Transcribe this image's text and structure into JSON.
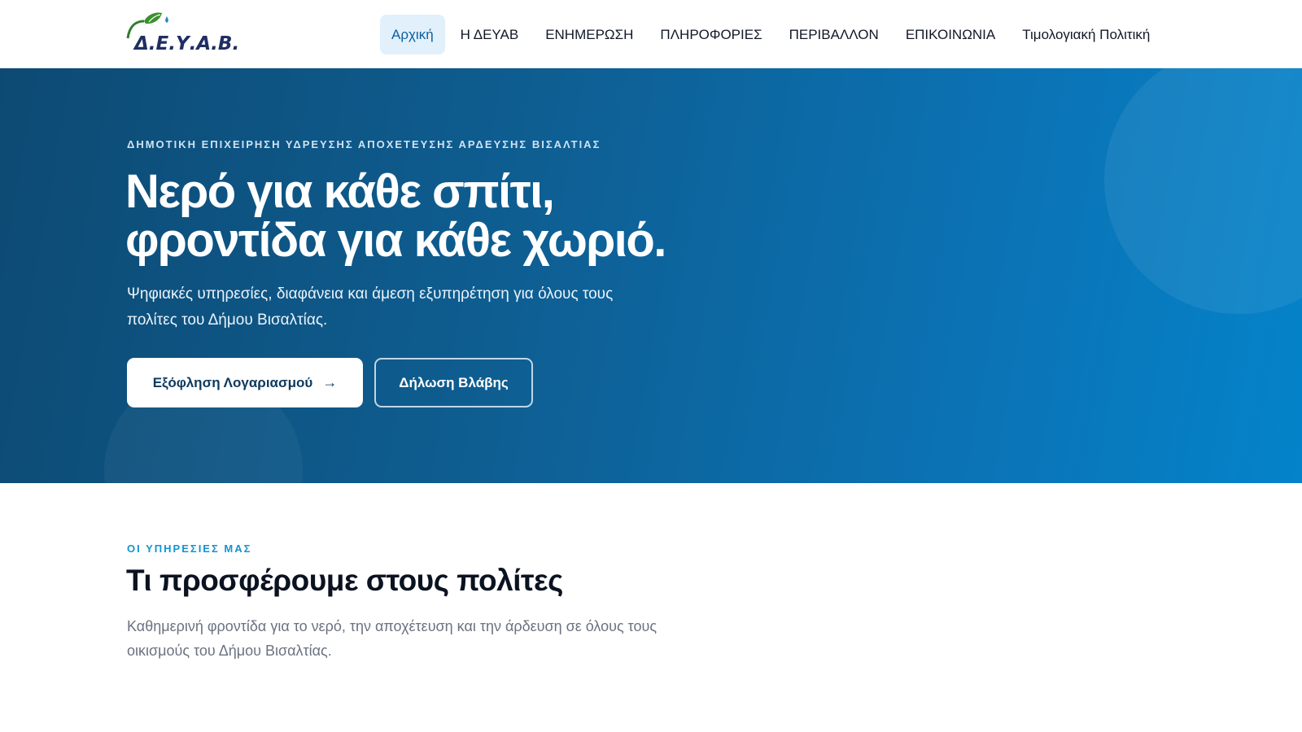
{
  "header": {
    "logo_text": "Δ.Ε.Υ.Α.Β.",
    "nav": [
      {
        "label": "Αρχική",
        "active": true
      },
      {
        "label": "Η ΔΕΥΑΒ"
      },
      {
        "label": "ΕΝΗΜΕΡΩΣΗ"
      },
      {
        "label": "ΠΛΗΡΟΦΟΡΙΕΣ"
      },
      {
        "label": "ΠΕΡΙΒΑΛΛΟΝ"
      },
      {
        "label": "ΕΠΙΚΟΙΝΩΝΙΑ"
      },
      {
        "label": "Τιμολογιακή Πολιτική"
      }
    ]
  },
  "hero": {
    "eyebrow": "ΔΗΜΟΤΙΚΗ ΕΠΙΧΕΙΡΗΣΗ ΥΔΡΕΥΣΗΣ ΑΠΟΧΕΤΕΥΣΗΣ ΑΡΔΕΥΣΗΣ ΒΙΣΑΛΤΙΑΣ",
    "title_line1": "Νερό για κάθε σπίτι,",
    "title_line2": "φροντίδα για κάθε χωριό.",
    "subtitle": "Ψηφιακές υπηρεσίες, διαφάνεια και άμεση εξυπηρέτηση για όλους τους πολίτες του Δήμου Βισαλτίας.",
    "primary_button": "Εξόφληση Λογαριασμού",
    "primary_button_icon": "arrow-right-icon",
    "secondary_button": "Δήλωση Βλάβης"
  },
  "services": {
    "eyebrow": "ΟΙ ΥΠΗΡΕΣΙΕΣ ΜΑΣ",
    "title": "Τι προσφέρουμε στους πολίτες",
    "description": "Καθημερινή φροντίδα για το νερό, την αποχέτευση και την άρδευση σε όλους τους οικισμούς του Δήμου Βισαλτίας."
  },
  "colors": {
    "brand_navy": "#1f2f63",
    "leaf_green": "#3a8f2e",
    "hero_start": "#0d4a73",
    "hero_end": "#0483ca",
    "accent_blue": "#1593d1",
    "nav_active_bg": "#e1f0fb"
  }
}
